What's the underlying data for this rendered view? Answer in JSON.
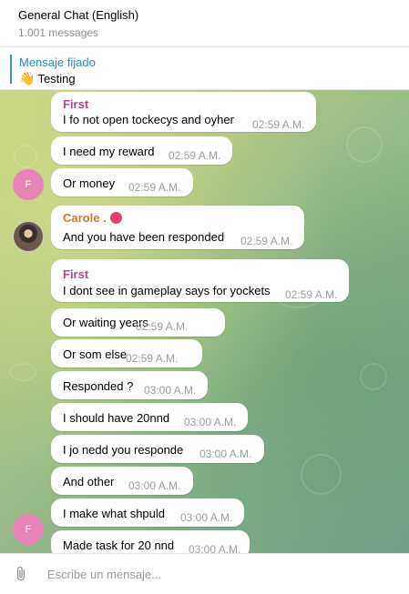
{
  "header": {
    "title": "General Chat (English)",
    "subtitle": "1.001 messages"
  },
  "pinned": {
    "title": "Mensaje fijado",
    "emoji": "👋",
    "text": "Testing"
  },
  "avatars": {
    "first_initial": "F"
  },
  "messages": [
    {
      "sender": "First",
      "text": "I fo not open tockecys and oyher",
      "time": "02:59 A.M."
    },
    {
      "text": "I need my reward",
      "time": "02:59 A.M."
    },
    {
      "text": "Or money",
      "time": "02:59 A.M."
    },
    {
      "sender": "Carole .",
      "text": "And you have been responded",
      "time": "02:59 A.M."
    },
    {
      "sender": "First",
      "text": "I dont see in gameplay says for yockets",
      "time": "02:59 A.M."
    },
    {
      "text": "Or waiting years",
      "time": "02:59 A.M."
    },
    {
      "text": "Or som else",
      "time": "02:59 A.M."
    },
    {
      "text": "Responded ?",
      "time": "03:00 A.M."
    },
    {
      "text": "I should have 20nnd",
      "time": "03:00 A.M."
    },
    {
      "text": "I jo nedd you responde",
      "time": "03:00 A.M."
    },
    {
      "text": "And other",
      "time": "03:00 A.M."
    },
    {
      "text": "I make what shpuld",
      "time": "03:00 A.M."
    },
    {
      "text": "Made task for 20 nnd",
      "time": "03:00 A.M."
    }
  ],
  "composer": {
    "placeholder": "Escribe un mensaje..."
  },
  "icons": {
    "attach": "paperclip-icon",
    "carole_badge": "red-emoji-icon"
  },
  "colors": {
    "first_name": "#b0488f",
    "carole_name": "#c97a33",
    "pinned_accent": "#2e86c6",
    "avatar_f": "#e685b5"
  }
}
